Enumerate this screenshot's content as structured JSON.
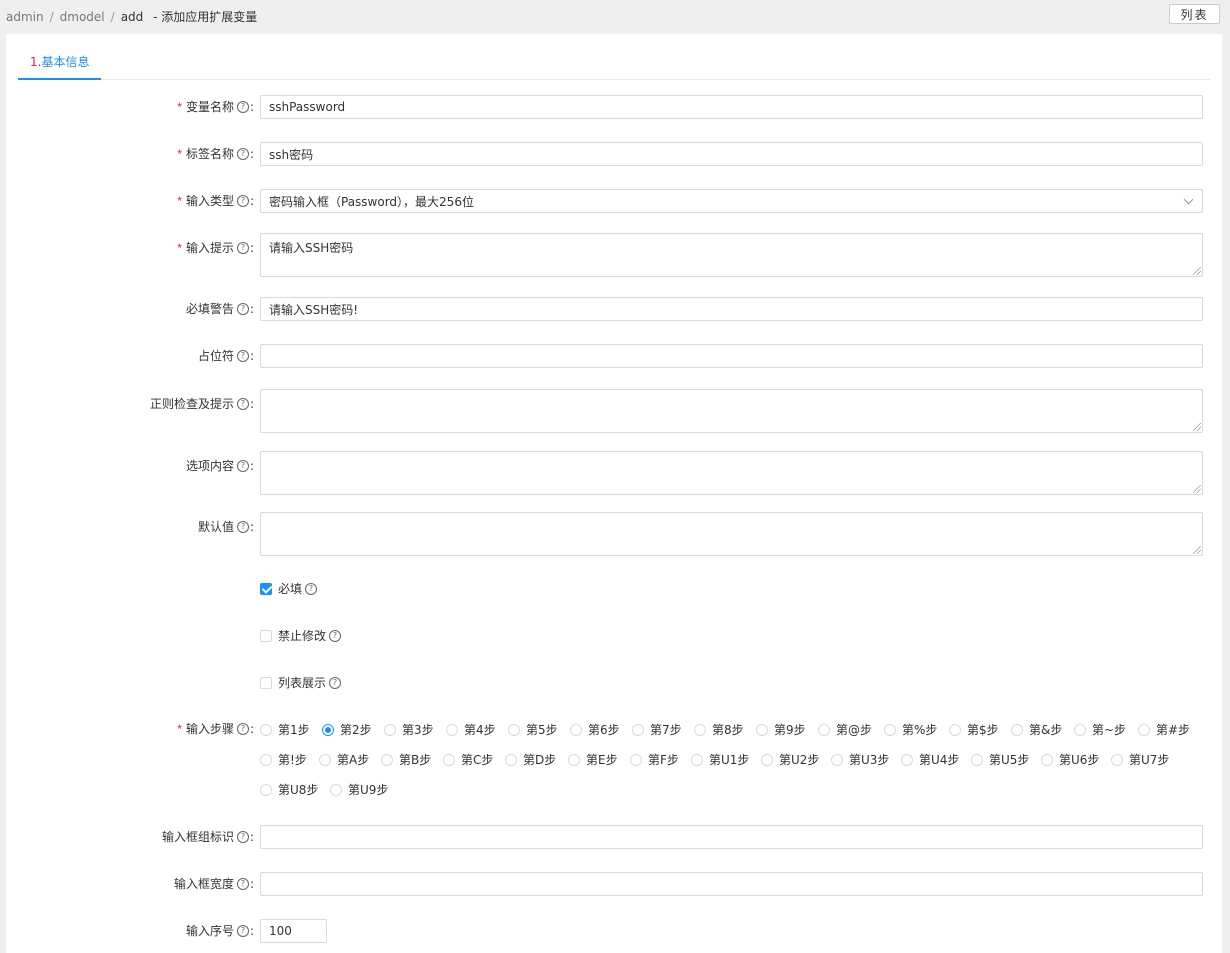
{
  "breadcrumb": {
    "items": [
      "admin",
      "dmodel",
      "add"
    ],
    "separator": "/",
    "suffix": "- 添加应用扩展变量"
  },
  "header": {
    "list_button": "列表"
  },
  "tabs": [
    {
      "number": "1.",
      "label": "基本信息"
    }
  ],
  "form": {
    "var_name": {
      "label": "变量名称",
      "value": "sshPassword",
      "required": true
    },
    "tag_name": {
      "label": "标签名称",
      "value": "ssh密码",
      "required": true
    },
    "input_type": {
      "label": "输入类型",
      "value": "密码输入框（Password），最大256位",
      "required": true
    },
    "input_hint": {
      "label": "输入提示",
      "value": "请输入SSH密码",
      "required": true
    },
    "required_warning": {
      "label": "必填警告",
      "value": "请输入SSH密码!",
      "required": false
    },
    "placeholder": {
      "label": "占位符",
      "value": ""
    },
    "regex": {
      "label": "正则检查及提示",
      "value": ""
    },
    "options": {
      "label": "选项内容",
      "value": ""
    },
    "default": {
      "label": "默认值",
      "value": ""
    },
    "check_required": {
      "label": "必填",
      "checked": true
    },
    "check_readonly": {
      "label": "禁止修改",
      "checked": false
    },
    "check_list_show": {
      "label": "列表展示",
      "checked": false
    },
    "step": {
      "label": "输入步骤",
      "required": true,
      "selected": "第2步",
      "options": [
        "第1步",
        "第2步",
        "第3步",
        "第4步",
        "第5步",
        "第6步",
        "第7步",
        "第8步",
        "第9步",
        "第@步",
        "第%步",
        "第$步",
        "第&步",
        "第~步",
        "第#步",
        "第!步",
        "第A步",
        "第B步",
        "第C步",
        "第D步",
        "第E步",
        "第F步",
        "第U1步",
        "第U2步",
        "第U3步",
        "第U4步",
        "第U5步",
        "第U6步",
        "第U7步",
        "第U8步",
        "第U9步"
      ]
    },
    "group_id": {
      "label": "输入框组标识",
      "value": ""
    },
    "width": {
      "label": "输入框宽度",
      "value": ""
    },
    "order": {
      "label": "输入序号",
      "value": "100"
    }
  },
  "colors": {
    "accent": "#1890ff",
    "required": "#f5222d"
  }
}
